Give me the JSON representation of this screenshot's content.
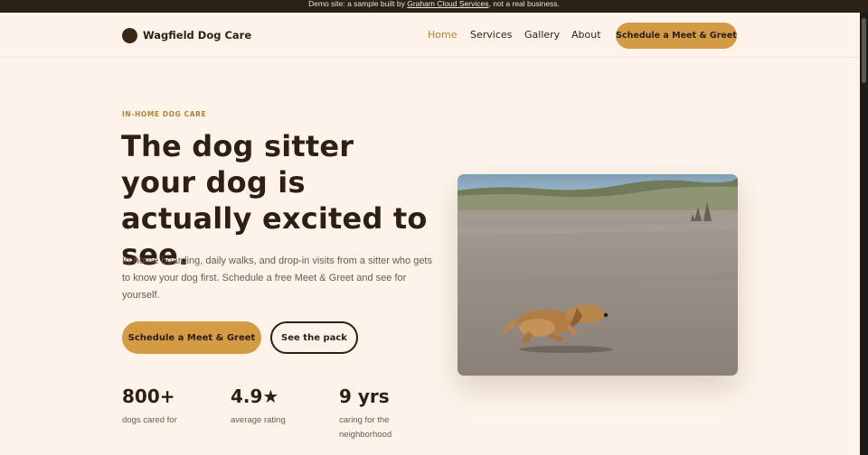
{
  "banner": {
    "prefix": "Demo site: a sample built by ",
    "link": "Graham Cloud Services",
    "suffix": ", not a real business."
  },
  "header": {
    "logo_text": "Wagfield Dog Care",
    "nav": [
      {
        "label": "Home",
        "active": true
      },
      {
        "label": "Services"
      },
      {
        "label": "Gallery"
      },
      {
        "label": "About"
      }
    ],
    "cta": "Schedule a Meet & Greet"
  },
  "hero": {
    "eyebrow": "IN-HOME DOG CARE",
    "headline": "The dog sitter your dog is actually excited to see.",
    "lead": "In-home boarding, daily walks, and drop-in visits from a sitter who gets to know your dog first. Schedule a free Meet & Greet and see for yourself.",
    "primary_button": "Schedule a Meet & Greet",
    "secondary_button": "See the pack"
  },
  "stats": [
    {
      "value": "800+",
      "label": "dogs cared for"
    },
    {
      "value": "4.9★",
      "label": "average rating"
    },
    {
      "value": "9 yrs",
      "label": "caring for the neighborhood"
    }
  ],
  "colors": {
    "accent": "#d49b45",
    "brand_dark": "#2e1f12",
    "background": "#fdf3ea",
    "eyebrow": "#b5822f"
  }
}
